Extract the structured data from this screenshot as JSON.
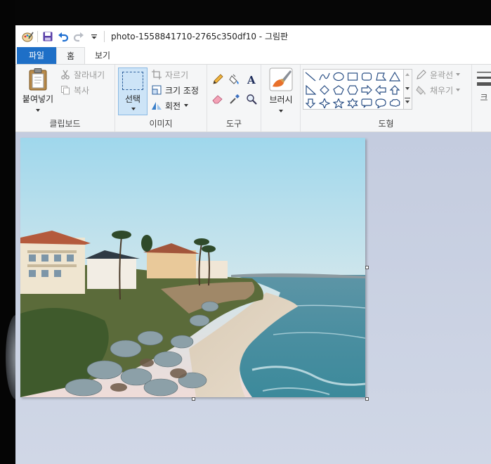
{
  "window": {
    "title": "photo-1558841710-2765c350df10 - 그림판"
  },
  "quick_access": {
    "icons": [
      "paint-app-icon",
      "save-icon",
      "undo-icon",
      "redo-icon",
      "customize-dropdown-icon"
    ]
  },
  "tabs": [
    {
      "label": "파일",
      "active": false
    },
    {
      "label": "홈",
      "active": true
    },
    {
      "label": "보기",
      "active": false
    }
  ],
  "ribbon": {
    "clipboard": {
      "label": "클립보드",
      "paste": "붙여넣기",
      "cut": "잘라내기",
      "copy": "복사"
    },
    "image": {
      "label": "이미지",
      "select": "선택",
      "crop": "자르기",
      "resize": "크기 조정",
      "rotate": "회전"
    },
    "tools": {
      "label": "도구",
      "items": [
        "pencil-icon",
        "fill-icon",
        "text-icon",
        "eraser-icon",
        "color-picker-icon",
        "magnifier-icon"
      ]
    },
    "brushes": {
      "label": "브러시"
    },
    "shapes": {
      "label": "도형",
      "outline": "윤곽선",
      "fill": "채우기",
      "items": [
        "line",
        "curve",
        "oval",
        "rectangle",
        "rounded-rectangle",
        "polygon",
        "triangle",
        "right-triangle",
        "diamond",
        "pentagon",
        "hexagon",
        "right-arrow",
        "left-arrow",
        "up-arrow",
        "down-arrow",
        "four-point-star",
        "five-point-star",
        "six-point-star",
        "rounded-callout",
        "oval-callout",
        "cloud-callout"
      ]
    },
    "size": {
      "label": "크"
    }
  },
  "colors": {
    "file_tab": "#1e6fc7",
    "ribbon_bg": "#f5f6f7",
    "canvas_bg": "#c8d0e2",
    "select_highlight": "#cde4f7"
  }
}
